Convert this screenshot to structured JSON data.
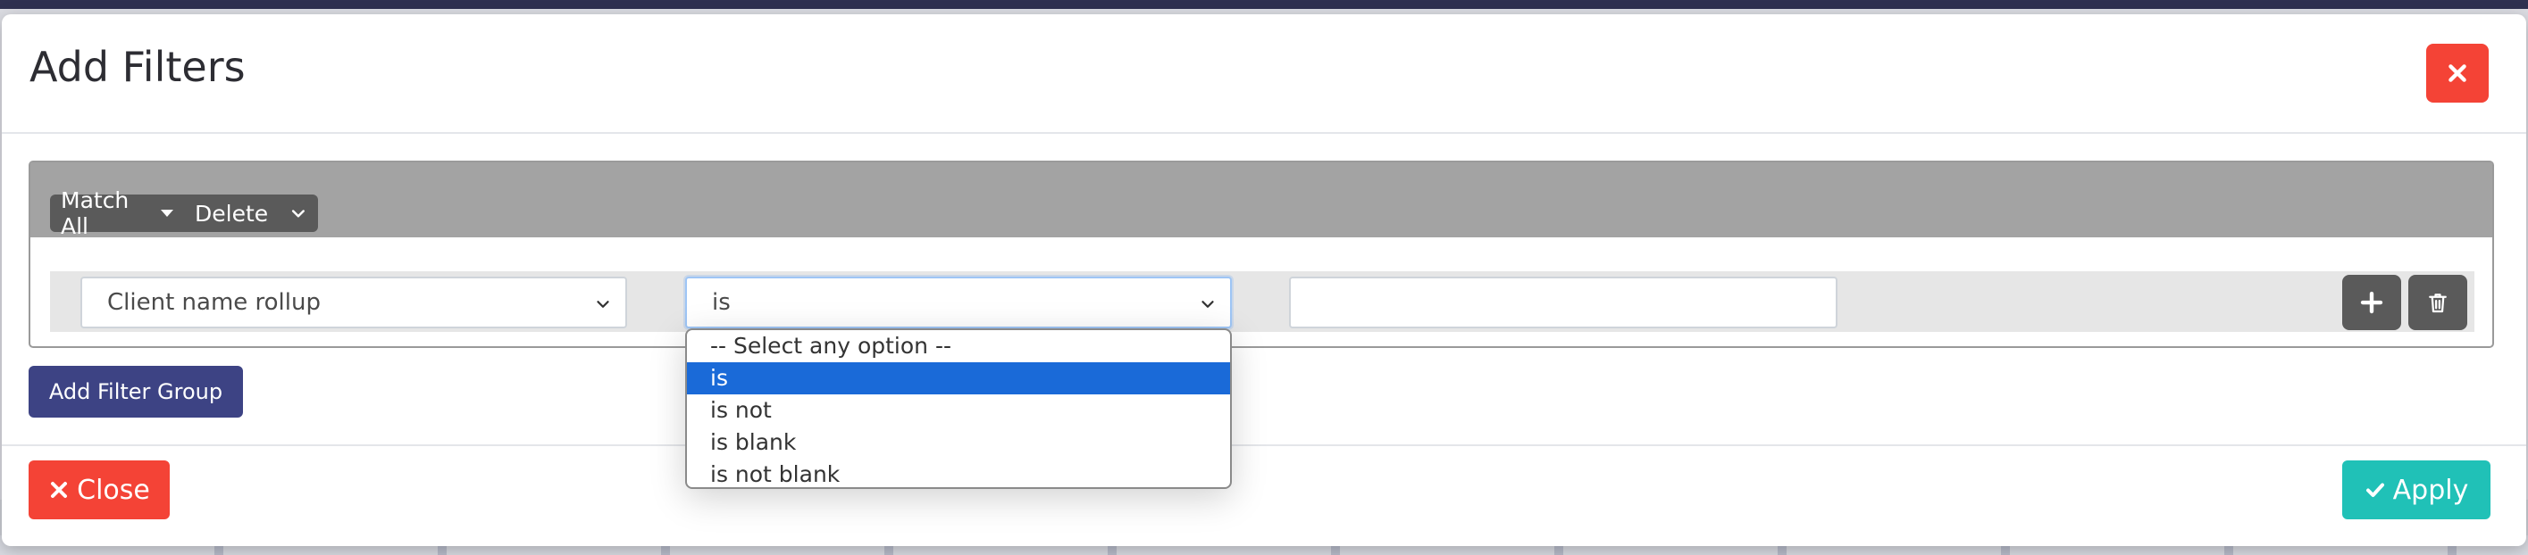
{
  "dialog": {
    "title": "Add Filters",
    "close_icon": "close-icon"
  },
  "filter_group": {
    "match_label": "Match All",
    "delete_label": "Delete",
    "rule": {
      "field_value": "Client name rollup",
      "operator_value": "is",
      "value": ""
    }
  },
  "operator_options": [
    {
      "label": "-- Select any option --"
    },
    {
      "label": "is"
    },
    {
      "label": "is not"
    },
    {
      "label": "is blank"
    },
    {
      "label": "is not blank"
    }
  ],
  "selected_option": "is",
  "add_filter_group_label": "Add Filter Group",
  "footer": {
    "close_label": "Close",
    "apply_label": "Apply"
  },
  "colors": {
    "danger": "#f44336",
    "success": "#20c1b7",
    "primary": "#3d4384",
    "selection": "#1a6ad8"
  }
}
